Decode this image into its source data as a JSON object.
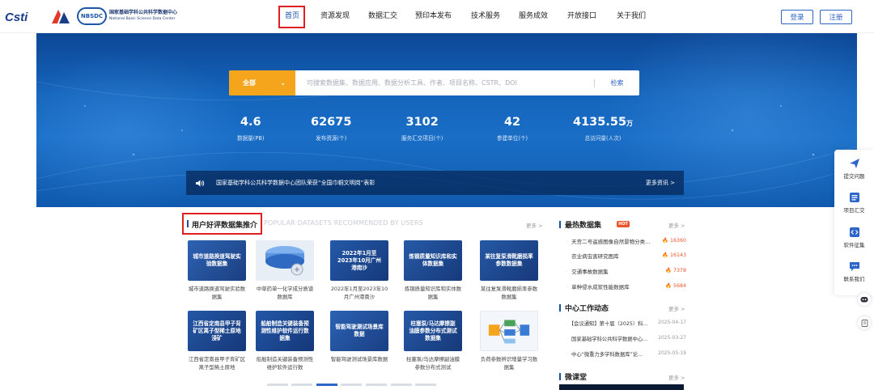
{
  "header": {
    "logo_cstr": "Csti",
    "logo_nbsdc_badge": "NBSDC",
    "logo_nbsdc_cn": "国家基础学科公共科学数据中心",
    "logo_nbsdc_en": "National Basic Science Data Center",
    "nav": [
      "首页",
      "资源发现",
      "数据汇交",
      "预印本发布",
      "技术服务",
      "服务成效",
      "开放接口",
      "关于我们"
    ],
    "active_nav": "首页",
    "login": "登录",
    "register": "注册"
  },
  "search": {
    "type": "全部",
    "placeholder": "可搜索数据集、数据应用、数据分析工具、作者、项目名称、CSTR、DOI",
    "button": "检索"
  },
  "stats": [
    {
      "value": "4.6",
      "unit": "",
      "label": "数据量(PB)"
    },
    {
      "value": "62675",
      "unit": "",
      "label": "发布资源(个)"
    },
    {
      "value": "3102",
      "unit": "",
      "label": "服务汇交项目(个)"
    },
    {
      "value": "42",
      "unit": "",
      "label": "参建单位(个)"
    },
    {
      "value": "4135.55",
      "unit": "万",
      "label": "总访问量(人次)"
    }
  ],
  "news_bar": {
    "text": "国家基础学科公共科学数据中心团队荣获“全国巾帼文明岗”表彰",
    "more": "更多资讯 >"
  },
  "datasets_section": {
    "title": "用户好评数据集推介",
    "subtitle": "POPULAR DATASETS RECOMMENDED BY USERS",
    "more": "更多 >",
    "cards": [
      {
        "thumb": "城市道路换道驾驶实验数据集",
        "name": "城市道路换道驾驶实验数据集",
        "color": "#2a5aa6"
      },
      {
        "thumb": "",
        "name": "中草药单一化学成分质谱数据库",
        "color": "#dfe6ef"
      },
      {
        "thumb": "2022年1月至2023年10月广州港南沙",
        "name": "2022年1月至2023年10月广州港南沙",
        "color": "#1d4f9c"
      },
      {
        "thumb": "炼钢质量知识库和实体数据集",
        "name": "炼钢质量知识库和实体数据集",
        "color": "#214f96"
      },
      {
        "thumb": "某往复泵滑靴磨损率参数数据集",
        "name": "某往复泵滑靴磨损率参数数据集",
        "color": "#1f4e94"
      },
      {
        "thumb": "江西省定南县甲子背矿区离子型稀土原地浸矿",
        "name": "江西省定南县甲子背矿区离子型稀土原地",
        "color": "#1c4b95"
      },
      {
        "thumb": "船舶制造关键装备预测性维护软件运行数据集",
        "name": "船舶制造关键装备预测性维护软件运行数",
        "color": "#1b4b96"
      },
      {
        "thumb": "智能驾驶测试场景库数据",
        "name": "智能驾驶测试场景库数据",
        "color": "#2456a4"
      },
      {
        "thumb": "柱塞泵/马达摩擦副油膜参数分布式测试数据集",
        "name": "柱塞泵/马达摩擦副油膜参数分布式测试",
        "color": "#1d4d98"
      },
      {
        "thumb": "",
        "name": "负荷参数辨识增量学习数据集",
        "color": "#f3f6fa"
      }
    ]
  },
  "hot_section": {
    "title": "最热数据集",
    "badge": "HOT",
    "more": "更多 >",
    "items": [
      {
        "name": "天宫二号遥感图像自然景物分类...",
        "count": "16360"
      },
      {
        "name": "农业病虫害研究图库",
        "count": "16143"
      },
      {
        "name": "交通事故数据集",
        "count": "7378"
      },
      {
        "name": "单种侵水成浆性能数据库",
        "count": "5684"
      }
    ]
  },
  "work_section": {
    "title": "中心工作动态",
    "more": "更多 >",
    "items": [
      {
        "text": "【会议通知】第十届（2025）科...",
        "date": "2025-04-17"
      },
      {
        "text": "国家基础学科公共科学数据中心...",
        "date": "2025-03-27"
      },
      {
        "text": "中心“微重力多学科数据库”论...",
        "date": "2025-05-19"
      }
    ]
  },
  "video_section": {
    "title": "微课堂",
    "more": "更多 >"
  },
  "side_tools": [
    {
      "icon": "paper-plane-icon",
      "label": "提交问题"
    },
    {
      "icon": "list-icon",
      "label": "项目汇交"
    },
    {
      "icon": "code-icon",
      "label": "软件征集"
    },
    {
      "icon": "chat-icon",
      "label": "联系我们"
    }
  ],
  "colors": {
    "primary": "#1a4fa8",
    "accent_orange": "#f4a51c",
    "hot_red": "#e8542c",
    "highlight_box": "#e02020"
  }
}
